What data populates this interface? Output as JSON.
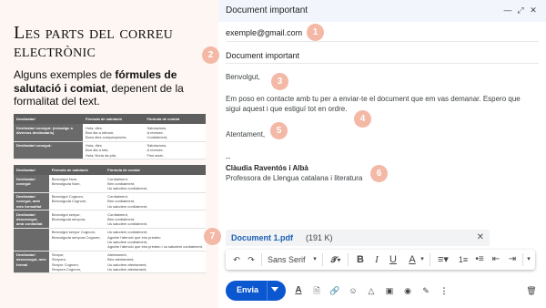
{
  "left": {
    "title": "Les parts del correu electrònic",
    "intro_prefix": "Alguns exemples de ",
    "intro_bold": "fórmules de salutació i comiat",
    "intro_suffix": ", depenent de la formalitat del text.",
    "table1": {
      "headers": [
        "Destinatari",
        "Fórmula de salutació",
        "Fórmula de comiat"
      ],
      "rows": [
        {
          "label": "Destinatari conegut: (missatge a diversos destinataris)",
          "greet": [
            "Hola, dies",
            "Bon dia a tothom,",
            "Bons dies companyes/es,"
          ],
          "close": [
            "Salutacions,",
            "A reveure,",
            "Cordialment,"
          ]
        },
        {
          "label": "Destinatari conegut:",
          "greet": [
            "Hola, dies",
            "Bon dia a tots,",
            "Hola, Núria da pila,"
          ],
          "close": [
            "Salutacions,",
            "A reveure,",
            "Fins aviat,"
          ]
        }
      ]
    },
    "table2": {
      "headers": [
        "Destinatari",
        "Fórmula de salutació",
        "Fórmula de comiat"
      ],
      "rows": [
        {
          "label": "Destinatari conegut",
          "greet": [
            "Benvolgut Nom,",
            "Benvolguda Nom,"
          ],
          "close": [
            "Cordialment,",
            "Ben cordialment,",
            "Us saludem cordialment,"
          ]
        },
        {
          "label": "Destinatari conegut, amb més formalitat",
          "greet": [
            "Benvolgut Cognom,",
            "Benvolguda Cognom,"
          ],
          "close": [
            "Cordialment,",
            "Ben cordialment,",
            "Us saludem cordialment,"
          ]
        },
        {
          "label": "Destinatari desconegut, amb cordialitat",
          "greet": [
            "Benvolgut senyor,",
            "Benvolguda senyora,"
          ],
          "close": [
            "Cordialment,",
            "Ben cordialment,",
            "Us saludem cordialment,"
          ]
        },
        {
          "label": "",
          "greet": [
            "Benvolgut senyor Cognom,",
            "Benvolguda senyora Cognom,"
          ],
          "close": [
            "Us saludem cordialment,",
            "Agraïm l'atenció que ens presteu",
            "Us saludem cordialment,",
            "Agraïm l'atenció que ens presteu i us saludem cordialment,"
          ]
        },
        {
          "label": "Destinatari desconegut, més formal",
          "greet": [
            "Senyor,",
            "Senyora,",
            "Senyor Cognom,",
            "Senyora Cognom,"
          ],
          "close": [
            "Atentament,",
            "Ben atentament,",
            "Us saludem atentament,",
            "Us saludem atentament,"
          ]
        }
      ]
    }
  },
  "compose": {
    "window_title": "Document important",
    "to": "exemple@gmail.com",
    "subject": "Document important",
    "greeting": "Benvolgut,",
    "body_line1": "Em poso en contacte amb tu per a enviar-te el document que em vas demanar. Espero que",
    "body_line2": "sigui aquest i que estiguí tot en ordre.",
    "closing": "Atentament,",
    "sig_dashes": "--",
    "sig_name": "Clàudia Raventós i Albà",
    "sig_role": "Professora de Llengua catalana i literatura",
    "attachment_name": "Document 1.pdf",
    "attachment_size": "(191 K)",
    "font_name": "Sans Serif",
    "send_label": "Envia"
  },
  "badges": [
    "1",
    "2",
    "3",
    "4",
    "5",
    "6",
    "7"
  ],
  "colors": {
    "badge": "#f4b8a6",
    "send": "#0b57d0",
    "link": "#1a5fb4",
    "left_bg": "#fdf6f3"
  }
}
